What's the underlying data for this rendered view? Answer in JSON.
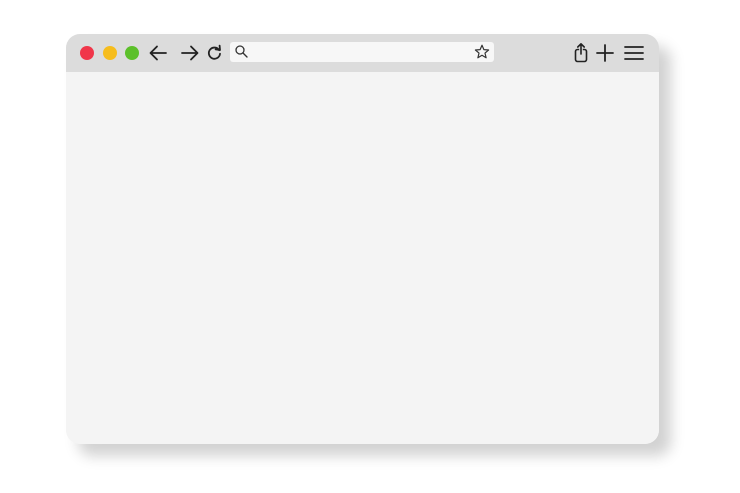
{
  "window": {
    "traffic_lights": [
      {
        "name": "close",
        "color": "#f0364a"
      },
      {
        "name": "minimize",
        "color": "#f6bd1d"
      },
      {
        "name": "maximize",
        "color": "#5cc02a"
      }
    ],
    "icons": {
      "back": "arrow-left-icon",
      "forward": "arrow-right-icon",
      "reload": "reload-icon",
      "search": "search-icon",
      "bookmark": "star-icon",
      "share": "share-icon",
      "new_tab": "plus-icon",
      "menu": "hamburger-menu-icon"
    },
    "colors": {
      "toolbar": "#dcdcdc",
      "content": "#f4f4f4",
      "address_bar": "#f7f7f7",
      "icon_stroke": "#222222"
    }
  },
  "address_bar": {
    "value": "",
    "placeholder": ""
  }
}
